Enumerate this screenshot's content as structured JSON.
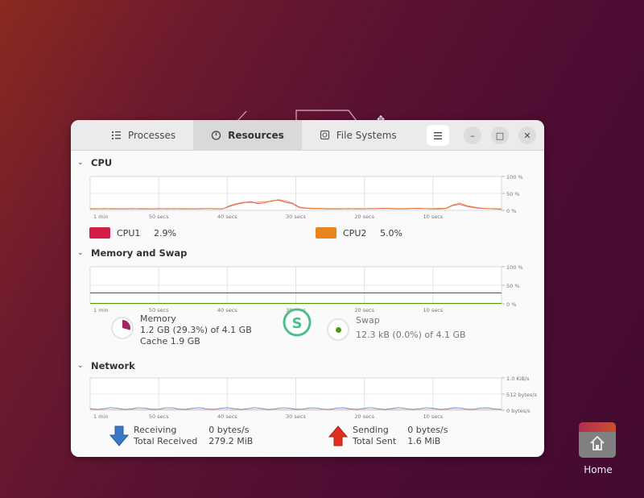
{
  "window": {
    "tabs": [
      {
        "label": "Processes",
        "icon": "list-icon",
        "active": false
      },
      {
        "label": "Resources",
        "icon": "gauge-icon",
        "active": true
      },
      {
        "label": "File Systems",
        "icon": "disk-icon",
        "active": false
      }
    ],
    "controls": {
      "menu": "hamburger-menu-icon",
      "minimize": "–",
      "maximize": "□",
      "close": "✕"
    }
  },
  "cpu": {
    "title": "CPU",
    "x_ticks": [
      "1 min",
      "50 secs",
      "40 secs",
      "30 secs",
      "20 secs",
      "10 secs"
    ],
    "y_ticks": [
      "100 %",
      "50 %",
      "0 %"
    ],
    "ylim": [
      0,
      100
    ],
    "series": [
      {
        "name": "CPU1",
        "value": "2.9%",
        "color": "#d41c48",
        "points": [
          4,
          4,
          5,
          4,
          4,
          4,
          5,
          4,
          4,
          4,
          5,
          4,
          5,
          4,
          4,
          4,
          5,
          5,
          4,
          4,
          12,
          18,
          22,
          26,
          20,
          22,
          28,
          30,
          24,
          20,
          8,
          6,
          5,
          5,
          4,
          4,
          4,
          5,
          4,
          4,
          5,
          5,
          6,
          5,
          4,
          4,
          5,
          6,
          5,
          4,
          4,
          5,
          14,
          18,
          12,
          8,
          6,
          5,
          4,
          3
        ]
      },
      {
        "name": "CPU2",
        "value": "5.0%",
        "color": "#e8831e",
        "points": [
          5,
          5,
          4,
          5,
          5,
          4,
          4,
          5,
          5,
          4,
          4,
          5,
          4,
          5,
          5,
          4,
          4,
          5,
          5,
          4,
          14,
          20,
          24,
          22,
          24,
          26,
          26,
          32,
          28,
          22,
          10,
          7,
          6,
          6,
          5,
          5,
          5,
          4,
          5,
          5,
          4,
          5,
          5,
          6,
          5,
          5,
          6,
          5,
          5,
          5,
          6,
          6,
          16,
          22,
          14,
          10,
          7,
          5,
          5,
          4
        ]
      }
    ]
  },
  "memory": {
    "title": "Memory and Swap",
    "x_ticks": [
      "1 min",
      "50 secs",
      "40 secs",
      "30 secs",
      "20 secs",
      "10 secs"
    ],
    "y_ticks": [
      "100 %",
      "50 %",
      "0 %"
    ],
    "memory_percent": 29.3,
    "swap_percent": 0.0,
    "memory_color": "#a3245e",
    "swap_color": "#4e9a06",
    "memory_label": "Memory",
    "memory_value": "1.2 GB (29.3%) of 4.1 GB",
    "cache_value": "Cache 1.9 GB",
    "swap_label": "Swap",
    "swap_value": "12.3 kB (0.0%) of 4.1 GB"
  },
  "network": {
    "title": "Network",
    "x_ticks": [
      "1 min",
      "50 secs",
      "40 secs",
      "30 secs",
      "20 secs",
      "10 secs"
    ],
    "y_ticks": [
      "1.0 KiB/s",
      "512 bytes/s",
      "0 bytes/s"
    ],
    "receiving_label": "Receiving",
    "receiving_value": "0 bytes/s",
    "total_received_label": "Total Received",
    "total_received_value": "279.2 MiB",
    "sending_label": "Sending",
    "sending_value": "0 bytes/s",
    "total_sent_label": "Total Sent",
    "total_sent_value": "1.6 MiB",
    "receive_color": "#3465a4",
    "send_color": "#cc0000"
  },
  "desktop": {
    "home_label": "Home"
  }
}
